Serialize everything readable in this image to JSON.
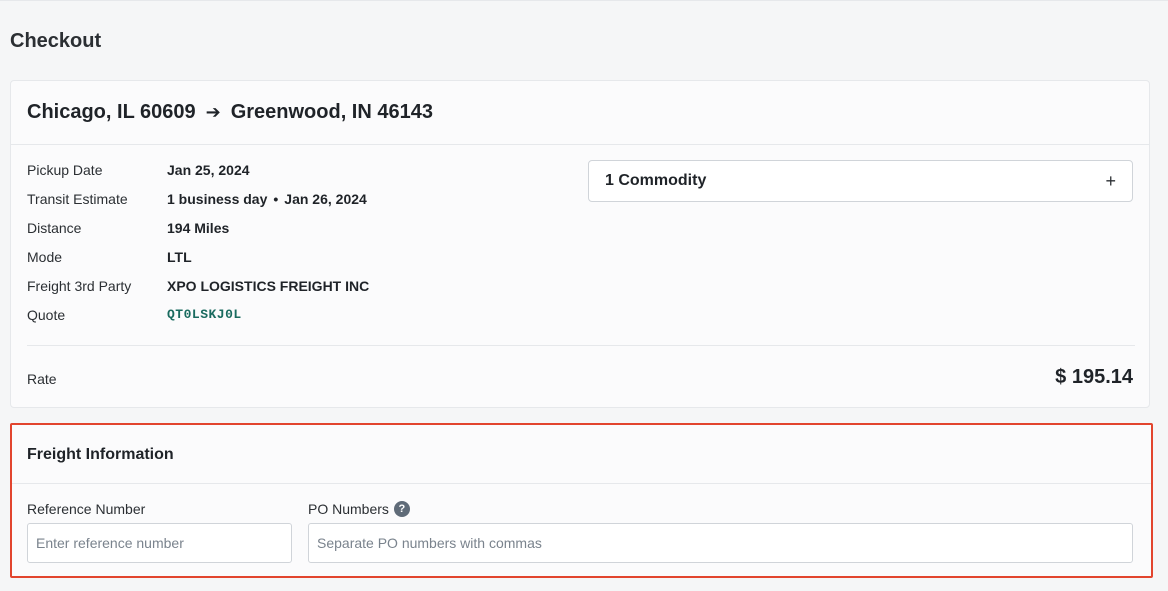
{
  "page": {
    "title": "Checkout"
  },
  "route": {
    "origin": "Chicago, IL 60609",
    "arrow": "➔",
    "destination": "Greenwood, IN 46143"
  },
  "details": {
    "pickup_label": "Pickup Date",
    "pickup_value": "Jan 25, 2024",
    "transit_label": "Transit Estimate",
    "transit_days": "1 business day",
    "transit_sep": "•",
    "transit_date": "Jan 26, 2024",
    "distance_label": "Distance",
    "distance_value": "194 Miles",
    "mode_label": "Mode",
    "mode_value": "LTL",
    "freight_label": "Freight 3rd Party",
    "freight_value": "XPO LOGISTICS FREIGHT INC",
    "quote_label": "Quote",
    "quote_value": "QT0LSKJ0L"
  },
  "commodity": {
    "label": "1 Commodity",
    "icon": "plus-icon",
    "icon_glyph": "+"
  },
  "rate": {
    "label": "Rate",
    "value": "$ 195.14"
  },
  "freight_info": {
    "title": "Freight Information",
    "reference_label": "Reference Number",
    "reference_placeholder": "Enter reference number",
    "reference_value": "",
    "po_label": "PO Numbers",
    "po_help_glyph": "?",
    "po_placeholder": "Separate PO numbers with commas",
    "po_value": ""
  },
  "colors": {
    "highlight_border": "#e2452e",
    "quote_link": "#1a6b5f",
    "background": "#f5f6f7"
  }
}
